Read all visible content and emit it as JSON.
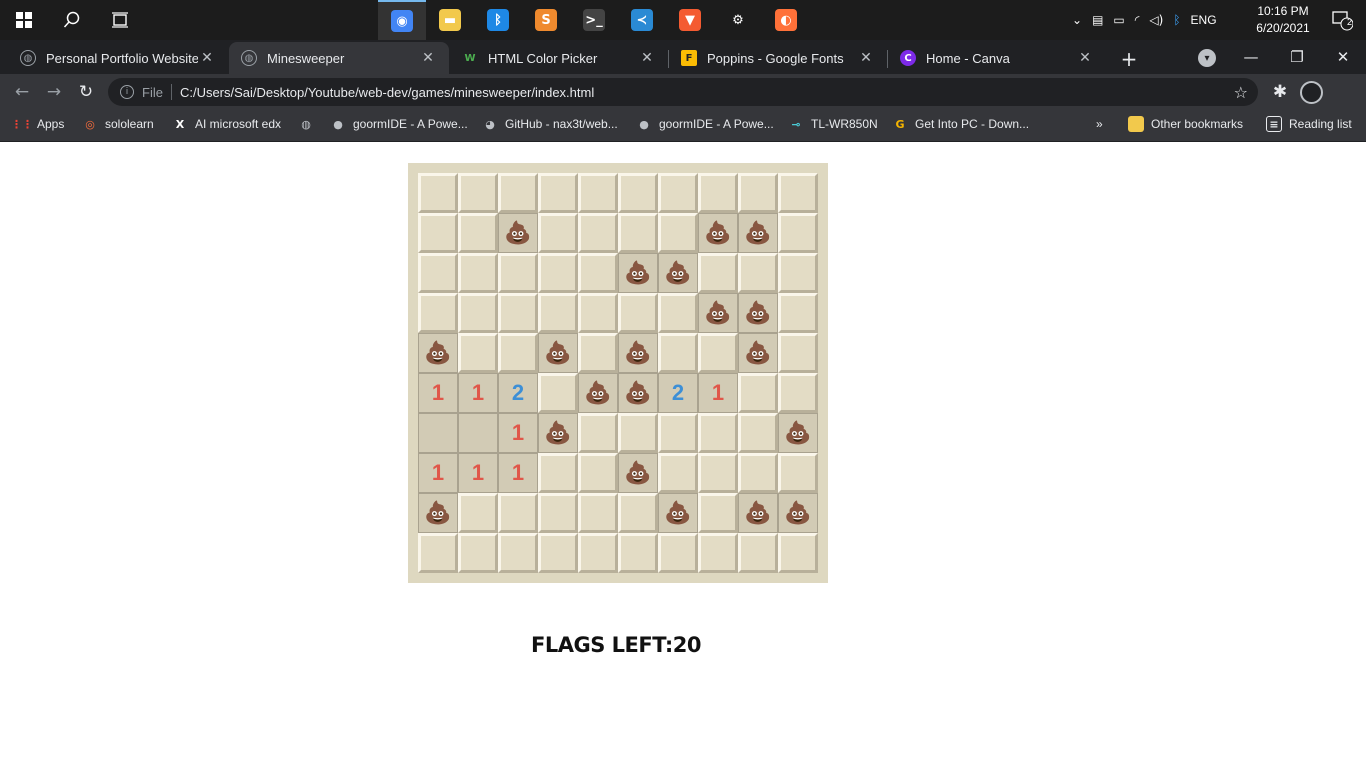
{
  "taskbar": {
    "apps": [
      {
        "name": "chrome-icon",
        "glyph": "◉",
        "color": "#4285f4",
        "active": true
      },
      {
        "name": "file-explorer-icon",
        "glyph": "▬",
        "color": "#f2c94c",
        "active": false
      },
      {
        "name": "bluetooth-icon",
        "glyph": "ᛒ",
        "color": "#1e88e5",
        "active": false
      },
      {
        "name": "sublime-text-icon",
        "glyph": "S",
        "color": "#ef8a2e",
        "active": false
      },
      {
        "name": "terminal-icon",
        "glyph": ">_",
        "color": "#444444",
        "active": false
      },
      {
        "name": "vscode-icon",
        "glyph": "≺",
        "color": "#2a8ad4",
        "active": false
      },
      {
        "name": "brave-icon",
        "glyph": "▼",
        "color": "#f45b31",
        "active": false
      },
      {
        "name": "settings-icon",
        "glyph": "⚙",
        "color": "#1c1c1c",
        "active": false
      },
      {
        "name": "firefox-icon",
        "glyph": "◐",
        "color": "#ff7139",
        "active": false
      }
    ],
    "language": "ENG",
    "time": "10:16 PM",
    "date": "6/20/2021",
    "notifications": "2"
  },
  "tabs": [
    {
      "title": "Personal Portfolio Website",
      "fav": "◍",
      "favColor": "#9aa0a6",
      "active": false
    },
    {
      "title": "Minesweeper",
      "fav": "◍",
      "favColor": "#9aa0a6",
      "active": true
    },
    {
      "title": "HTML Color Picker",
      "fav": "W",
      "favColor": "#4caf50",
      "active": false
    },
    {
      "title": "Poppins - Google Fonts",
      "fav": "F",
      "favColor": "#fbbc04",
      "active": false
    },
    {
      "title": "Home - Canva",
      "fav": "C",
      "favColor": "#7d2ae8",
      "active": false
    }
  ],
  "address": {
    "protocol": "File",
    "url": "C:/Users/Sai/Desktop/Youtube/web-dev/games/minesweeper/index.html"
  },
  "bookmarks": [
    {
      "label": "Apps",
      "icon": "apps-grid-icon",
      "glyph": "⋮⋮",
      "color": "#ea4335"
    },
    {
      "label": "sololearn",
      "icon": "sololearn-icon",
      "glyph": "◎",
      "color": "#ff6f3c"
    },
    {
      "label": "AI microsoft edx",
      "icon": "edx-icon",
      "glyph": "X",
      "color": "#ffffff"
    },
    {
      "label": "",
      "icon": "globe-icon",
      "glyph": "◍",
      "color": "#bdc1c6"
    },
    {
      "label": "goormIDE - A Powe...",
      "icon": "person-icon",
      "glyph": "●",
      "color": "#bdc1c6"
    },
    {
      "label": "GitHub - nax3t/web...",
      "icon": "github-icon",
      "glyph": "◕",
      "color": "#bdc1c6"
    },
    {
      "label": "goormIDE - A Powe...",
      "icon": "person-icon",
      "glyph": "●",
      "color": "#bdc1c6"
    },
    {
      "label": "TL-WR850N",
      "icon": "tplink-icon",
      "glyph": "⊸",
      "color": "#4acbd6"
    },
    {
      "label": "Get Into PC - Down...",
      "icon": "getintopc-icon",
      "glyph": "G",
      "color": "#f4b400"
    }
  ],
  "bookmarks_right": {
    "more": "»",
    "other": "Other bookmarks",
    "reading": "Reading list"
  },
  "game": {
    "mine_glyph": "💩",
    "board": [
      [
        "h",
        "h",
        "h",
        "h",
        "h",
        "h",
        "h",
        "h",
        "h",
        "h"
      ],
      [
        "h",
        "h",
        "M",
        "h",
        "h",
        "h",
        "h",
        "M",
        "M",
        "h"
      ],
      [
        "h",
        "h",
        "h",
        "h",
        "h",
        "M",
        "M",
        "h",
        "h",
        "h"
      ],
      [
        "h",
        "h",
        "h",
        "h",
        "h",
        "h",
        "h",
        "M",
        "M",
        "h"
      ],
      [
        "M",
        "h",
        "h",
        "M",
        "h",
        "M",
        "h",
        "h",
        "M",
        "h"
      ],
      [
        "1",
        "1",
        "2",
        "h",
        "M",
        "M",
        "2",
        "1",
        "h",
        "h"
      ],
      [
        "0",
        "0",
        "1",
        "M",
        "h",
        "h",
        "h",
        "h",
        "h",
        "M"
      ],
      [
        "1",
        "1",
        "1",
        "h",
        "h",
        "M",
        "h",
        "h",
        "h",
        "h"
      ],
      [
        "M",
        "h",
        "h",
        "h",
        "h",
        "h",
        "M",
        "h",
        "M",
        "M"
      ],
      [
        "h",
        "h",
        "h",
        "h",
        "h",
        "h",
        "h",
        "h",
        "h",
        "h"
      ]
    ],
    "flags_text": "FLAGS LEFT:20"
  }
}
